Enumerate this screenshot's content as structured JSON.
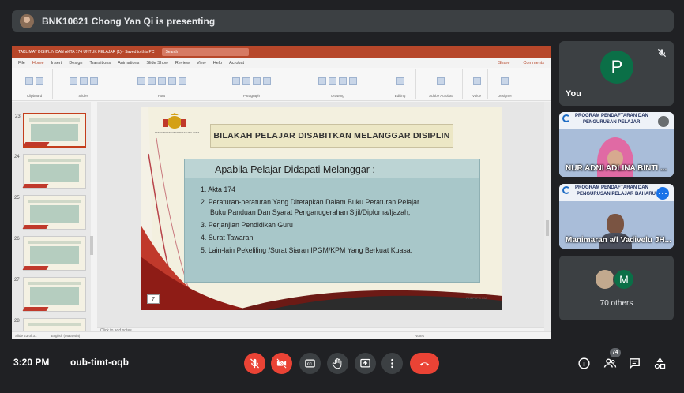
{
  "banner": {
    "text": "BNK10621 Chong Yan Qi is presenting"
  },
  "ppt": {
    "title_bar": "TAKLIMAT DISIPLIN DAN AKTA 174 UNTUK PELAJAR (1)  ·  Saved to this PC",
    "search": "Search",
    "menu": [
      "File",
      "Home",
      "Insert",
      "Design",
      "Transitions",
      "Animations",
      "Slide Show",
      "Review",
      "View",
      "Help",
      "Acrobat"
    ],
    "share": "Share",
    "comments": "Comments",
    "ribbon_groups": [
      "Clipboard",
      "Slides",
      "Font",
      "Paragraph",
      "Drawing",
      "Editing",
      "Adobe Acrobat",
      "Voice",
      "Designer"
    ],
    "thumb_numbers": [
      "23",
      "24",
      "25",
      "26",
      "27",
      "28"
    ],
    "notes_placeholder": "Click to add notes",
    "status_left": "Slide 23 of 31",
    "status_lang": "English (Malaysia)",
    "status_notes": "Notes"
  },
  "slide": {
    "title": "BILAKAH PELAJAR DISABITKAN MELANGGAR  DISIPLIN",
    "logo_caption": "KEMENTERIAN PENDIDIKAN MALAYSIA",
    "heading": "Apabila Pelajar Didapati Melanggar :",
    "items": [
      "1.  Akta 174",
      "2.  Peraturan-peraturan Yang Ditetapkan Dalam Buku Peraturan Pelajar",
      "Buku Panduan Dan Syarat Penganugerahan Sijil/Diploma/Ijazah,",
      "3.  Perjanjian Pendidikan Guru",
      "4.  Surat Tawaran",
      "5.  Lain-lain Pekeliling /Surat Siaran IPGM/KPM Yang Berkuat Kuasa."
    ],
    "page_number": "7",
    "footer": "PHEP IPG KM"
  },
  "participants": {
    "you": {
      "initial": "P",
      "name": "You"
    },
    "p1": {
      "header1": "PROGRAM PENDAFTARAN DAN",
      "header2": "PENGURUSAN PELAJAR",
      "name": "NUR ADNI ADLINA BINTI ..."
    },
    "p2": {
      "header1": "PROGRAM PENDAFTARAN DAN",
      "header2": "PENGURUSAN PELAJAR BAHARU",
      "name": "Manimaran a/l Vadivelu JH..."
    },
    "others": {
      "initial": "M",
      "text": "70 others"
    }
  },
  "bottom": {
    "time": "3:20 PM",
    "meeting_code": "oub-timt-oqb",
    "people_count": "74"
  },
  "colors": {
    "accent_red": "#ea4335",
    "bg": "#202124",
    "tile": "#3c4043",
    "avatar_green": "#0b6f47"
  }
}
